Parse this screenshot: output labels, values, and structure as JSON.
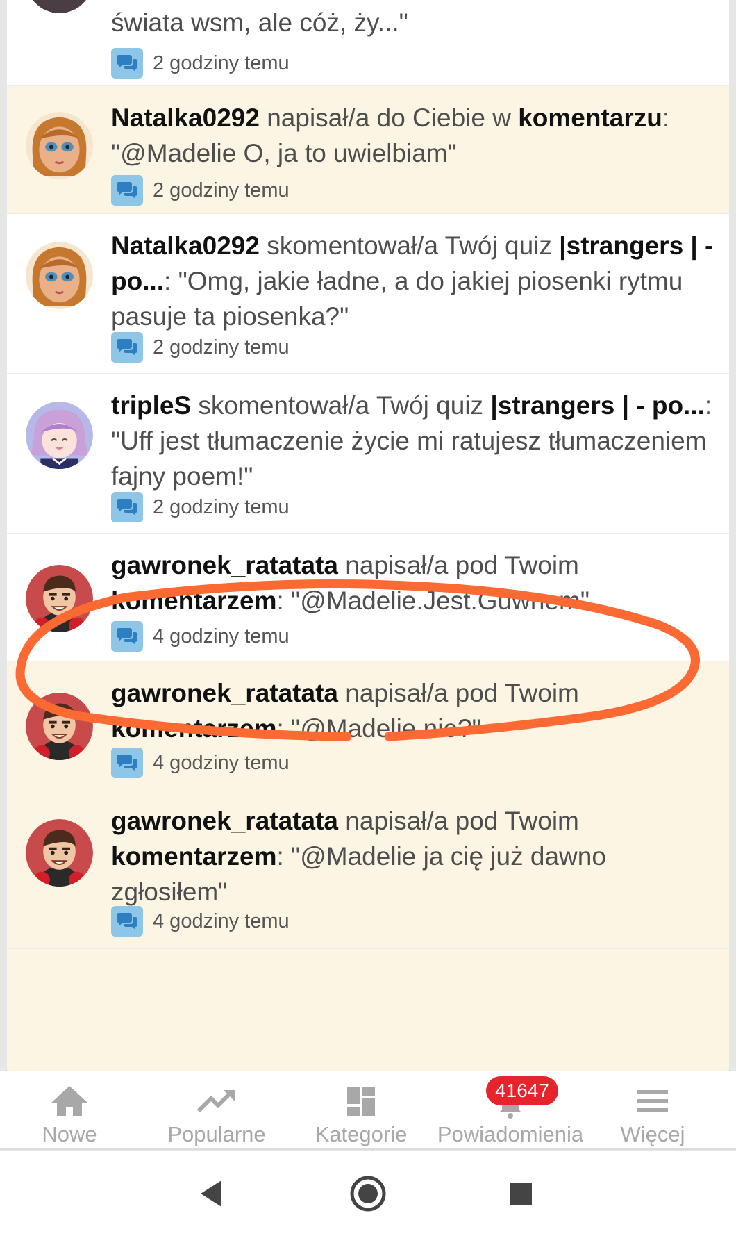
{
  "feed": {
    "notifications": [
      {
        "user": "",
        "action": "",
        "target": "",
        "sep": "",
        "text": "świata wsm, ale cóż, ży...\"",
        "time": "2 godziny temu"
      },
      {
        "user": "Natalka0292",
        "action": " napisał/a do Ciebie w ",
        "target": "komentarzu",
        "sep": ": ",
        "text": "\"@Madelie O, ja to uwielbiam\"",
        "time": "2 godziny temu"
      },
      {
        "user": "Natalka0292",
        "action": " skomentował/a Twój quiz ",
        "target": "|strangers | - po...",
        "sep": ": ",
        "text": "\"Omg, jakie ładne, a do jakiej piosenki rytmu pasuje ta piosenka?\"",
        "time": "2 godziny temu"
      },
      {
        "user": "tripleS",
        "action": " skomentował/a Twój quiz ",
        "target": "|strangers | - po...",
        "sep": ": ",
        "text": "\"Uff jest tłumaczenie życie mi ratujesz tłumaczeniem fajny poem!\"",
        "time": "2 godziny temu"
      },
      {
        "user": "gawronek_ratatata",
        "action": " napisał/a pod Twoim ",
        "target": "komentarzem",
        "sep": ": ",
        "text": "\"@Madelie.Jest.Guwnem\"",
        "time": "4 godziny temu"
      },
      {
        "user": "gawronek_ratatata",
        "action": " napisał/a pod Twoim ",
        "target": "komentarzem",
        "sep": ": ",
        "text": "\"@Madelie nie?\"",
        "time": "4 godziny temu"
      },
      {
        "user": "gawronek_ratatata",
        "action": " napisał/a pod Twoim ",
        "target": "komentarzem",
        "sep": ": ",
        "text": "\"@Madelie ja cię już dawno zgłosiłem\"",
        "time": "4 godziny temu"
      }
    ]
  },
  "nav": {
    "new_label": "Nowe",
    "popular_label": "Popularne",
    "categories_label": "Kategorie",
    "notifications_label": "Powiadomienia",
    "notifications_badge": "41647",
    "more_label": "Więcej"
  },
  "colors": {
    "unread_background": "#fdf5e4",
    "badge": "#e7232b",
    "comment_icon": "#8ec6e8",
    "annotation": "#fb6a33"
  }
}
